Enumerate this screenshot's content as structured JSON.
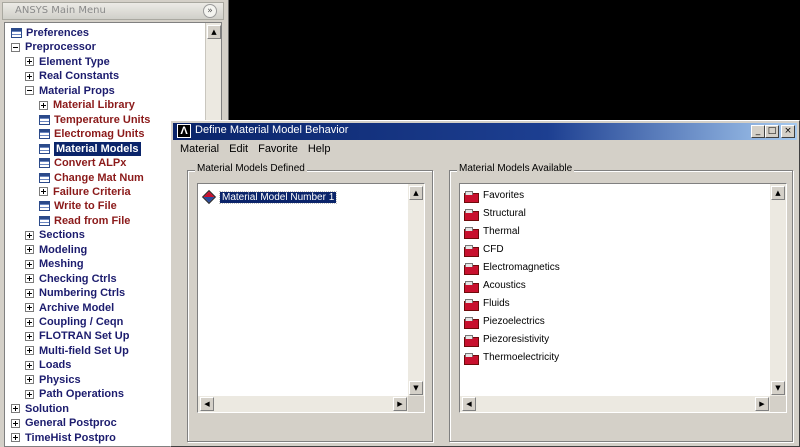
{
  "main_menu": {
    "title": "ANSYS Main Menu",
    "collapse_glyph": "»",
    "items": [
      {
        "label": "Preferences",
        "icon": "doc",
        "color": "blue",
        "indent": 0
      },
      {
        "label": "Preprocessor",
        "icon": "minus",
        "color": "blue",
        "indent": 0
      },
      {
        "label": "Element Type",
        "icon": "plus",
        "color": "blue",
        "indent": 1
      },
      {
        "label": "Real Constants",
        "icon": "plus",
        "color": "blue",
        "indent": 1
      },
      {
        "label": "Material Props",
        "icon": "minus",
        "color": "blue",
        "indent": 1
      },
      {
        "label": "Material Library",
        "icon": "plus",
        "color": "red",
        "indent": 2
      },
      {
        "label": "Temperature Units",
        "icon": "doc",
        "color": "red",
        "indent": 2
      },
      {
        "label": "Electromag Units",
        "icon": "doc",
        "color": "red",
        "indent": 2
      },
      {
        "label": "Material Models",
        "icon": "doc",
        "color": "red",
        "indent": 2,
        "selected": true
      },
      {
        "label": "Convert ALPx",
        "icon": "doc",
        "color": "red",
        "indent": 2
      },
      {
        "label": "Change Mat Num",
        "icon": "doc",
        "color": "red",
        "indent": 2
      },
      {
        "label": "Failure Criteria",
        "icon": "plus",
        "color": "red",
        "indent": 2
      },
      {
        "label": "Write to File",
        "icon": "doc",
        "color": "red",
        "indent": 2
      },
      {
        "label": "Read from File",
        "icon": "doc",
        "color": "red",
        "indent": 2
      },
      {
        "label": "Sections",
        "icon": "plus",
        "color": "blue",
        "indent": 1
      },
      {
        "label": "Modeling",
        "icon": "plus",
        "color": "blue",
        "indent": 1
      },
      {
        "label": "Meshing",
        "icon": "plus",
        "color": "blue",
        "indent": 1
      },
      {
        "label": "Checking Ctrls",
        "icon": "plus",
        "color": "blue",
        "indent": 1
      },
      {
        "label": "Numbering Ctrls",
        "icon": "plus",
        "color": "blue",
        "indent": 1
      },
      {
        "label": "Archive Model",
        "icon": "plus",
        "color": "blue",
        "indent": 1
      },
      {
        "label": "Coupling / Ceqn",
        "icon": "plus",
        "color": "blue",
        "indent": 1
      },
      {
        "label": "FLOTRAN Set Up",
        "icon": "plus",
        "color": "blue",
        "indent": 1
      },
      {
        "label": "Multi-field Set Up",
        "icon": "plus",
        "color": "blue",
        "indent": 1
      },
      {
        "label": "Loads",
        "icon": "plus",
        "color": "blue",
        "indent": 1
      },
      {
        "label": "Physics",
        "icon": "plus",
        "color": "blue",
        "indent": 1
      },
      {
        "label": "Path Operations",
        "icon": "plus",
        "color": "blue",
        "indent": 1
      },
      {
        "label": "Solution",
        "icon": "plus",
        "color": "blue",
        "indent": 0
      },
      {
        "label": "General Postproc",
        "icon": "plus",
        "color": "blue",
        "indent": 0
      },
      {
        "label": "TimeHist Postpro",
        "icon": "plus",
        "color": "blue",
        "indent": 0
      }
    ]
  },
  "dialog": {
    "title": "Define Material Model Behavior",
    "app_icon_letter": "Λ",
    "window_buttons": {
      "minimize": "_",
      "restore": "□",
      "close": "×"
    },
    "menu": [
      "Material",
      "Edit",
      "Favorite",
      "Help"
    ],
    "defined": {
      "title": "Material Models Defined",
      "items": [
        "Material Model Number 1"
      ]
    },
    "available": {
      "title": "Material Models Available",
      "items": [
        "Favorites",
        "Structural",
        "Thermal",
        "CFD",
        "Electromagnetics",
        "Acoustics",
        "Fluids",
        "Piezoelectrics",
        "Piezoresistivity",
        "Thermoelectricity"
      ]
    },
    "scroll_glyphs": {
      "up": "▲",
      "down": "▼",
      "left": "◀",
      "right": "▶"
    }
  },
  "colors": {
    "selection": "#0a246a",
    "tree_blue_text": "#1c1c6e",
    "tree_red_text": "#8b1a1a",
    "folder_icon": "#c8102e"
  }
}
